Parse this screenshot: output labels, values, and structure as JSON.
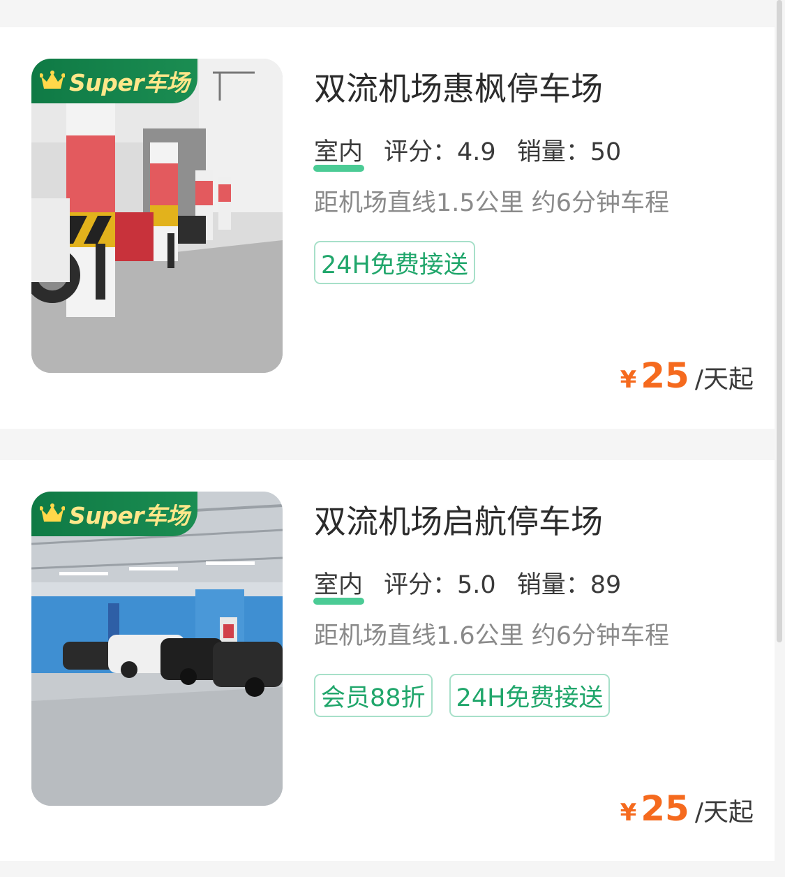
{
  "listings": [
    {
      "badge": "Super车场",
      "title": "双流机场惠枫停车场",
      "type": "室内",
      "score_label": "评分：",
      "score": "4.9",
      "sales_label": "销量：",
      "sales": "50",
      "distance": "距机场直线1.5公里 约6分钟车程",
      "tags": [
        "24H免费接送"
      ],
      "currency": "¥",
      "price": "25",
      "unit": "/天起"
    },
    {
      "badge": "Super车场",
      "title": "双流机场启航停车场",
      "type": "室内",
      "score_label": "评分：",
      "score": "5.0",
      "sales_label": "销量：",
      "sales": "89",
      "distance": "距机场直线1.6公里 约6分钟车程",
      "tags": [
        "会员88折",
        "24H免费接送"
      ],
      "currency": "¥",
      "price": "25",
      "unit": "/天起"
    }
  ],
  "colors": {
    "brand_green": "#1b8d52",
    "tag_green": "#20a66b",
    "price_orange": "#f56a1e",
    "badge_text": "#ffe78a"
  },
  "icons": [
    "crown-icon"
  ]
}
